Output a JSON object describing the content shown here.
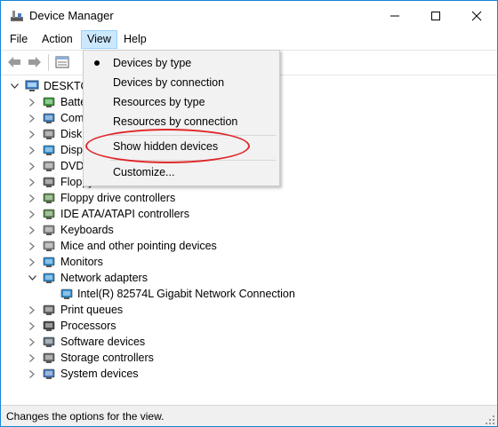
{
  "window": {
    "title": "Device Manager"
  },
  "menubar": {
    "file": "File",
    "action": "Action",
    "view": "View",
    "help": "Help"
  },
  "view_menu": {
    "items": [
      {
        "label": "Devices by type",
        "checked": true
      },
      {
        "label": "Devices by connection"
      },
      {
        "label": "Resources by type"
      },
      {
        "label": "Resources by connection"
      },
      {
        "label": "Show hidden devices",
        "highlighted": true
      },
      {
        "label": "Customize..."
      }
    ]
  },
  "tree": {
    "root": "DESKTO",
    "nodes": [
      {
        "label": "Batte",
        "icon": "battery-icon"
      },
      {
        "label": "Com",
        "icon": "computer-icon"
      },
      {
        "label": "Disk",
        "icon": "disk-icon"
      },
      {
        "label": "Disp",
        "icon": "display-icon"
      },
      {
        "label": "DVD",
        "icon": "dvd-icon"
      },
      {
        "label": "Floppy disk drives",
        "icon": "floppy-icon"
      },
      {
        "label": "Floppy drive controllers",
        "icon": "controller-icon"
      },
      {
        "label": "IDE ATA/ATAPI controllers",
        "icon": "ide-icon"
      },
      {
        "label": "Keyboards",
        "icon": "keyboard-icon"
      },
      {
        "label": "Mice and other pointing devices",
        "icon": "mouse-icon"
      },
      {
        "label": "Monitors",
        "icon": "monitor-icon"
      },
      {
        "label": "Network adapters",
        "icon": "network-icon",
        "expanded": true
      },
      {
        "label": "Intel(R) 82574L Gigabit Network Connection",
        "icon": "network-card-icon",
        "child": true
      },
      {
        "label": "Print queues",
        "icon": "printer-icon"
      },
      {
        "label": "Processors",
        "icon": "processor-icon"
      },
      {
        "label": "Software devices",
        "icon": "software-icon"
      },
      {
        "label": "Storage controllers",
        "icon": "storage-icon"
      },
      {
        "label": "System devices",
        "icon": "system-icon"
      }
    ]
  },
  "status": {
    "text": "Changes the options for the view."
  },
  "colors": {
    "accent": "#1883d7",
    "menu_highlight": "#cce8ff",
    "annotation": "#e0282b"
  }
}
